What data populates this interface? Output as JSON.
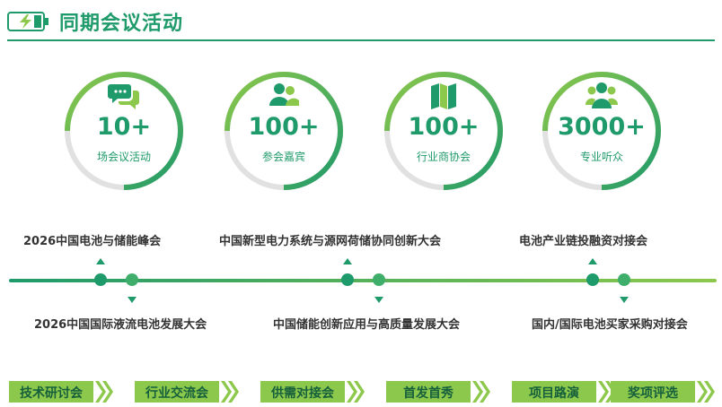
{
  "header": {
    "title": "同期会议活动",
    "accent_color": "#1f9a6a",
    "icon": "battery-charging-icon"
  },
  "stats": [
    {
      "number": "10+",
      "label": "场会议活动",
      "icon": "chat-bubbles-icon"
    },
    {
      "number": "100+",
      "label": "参会嘉宾",
      "icon": "people-icon"
    },
    {
      "number": "100+",
      "label": "行业商协会",
      "icon": "map-icon"
    },
    {
      "number": "3000+",
      "label": "专业听众",
      "icon": "audience-icon"
    }
  ],
  "events_top": [
    "2026中国电池与储能峰会",
    "中国新型电力系统与源网荷储协同创新大会",
    "电池产业链投融资对接会"
  ],
  "events_bottom": [
    "2026中国国际液流电池发展大会",
    "中国储能创新应用与高质量发展大会",
    "国内/国际电池买家采购对接会"
  ],
  "tags": [
    "技术研讨会",
    "行业交流会",
    "供需对接会",
    "首发首秀",
    "项目路演",
    "奖项评选"
  ],
  "colors": {
    "primary": "#1f9a6a",
    "light_green": "#8cc84b",
    "ring_gray": "#e1e1e1"
  }
}
